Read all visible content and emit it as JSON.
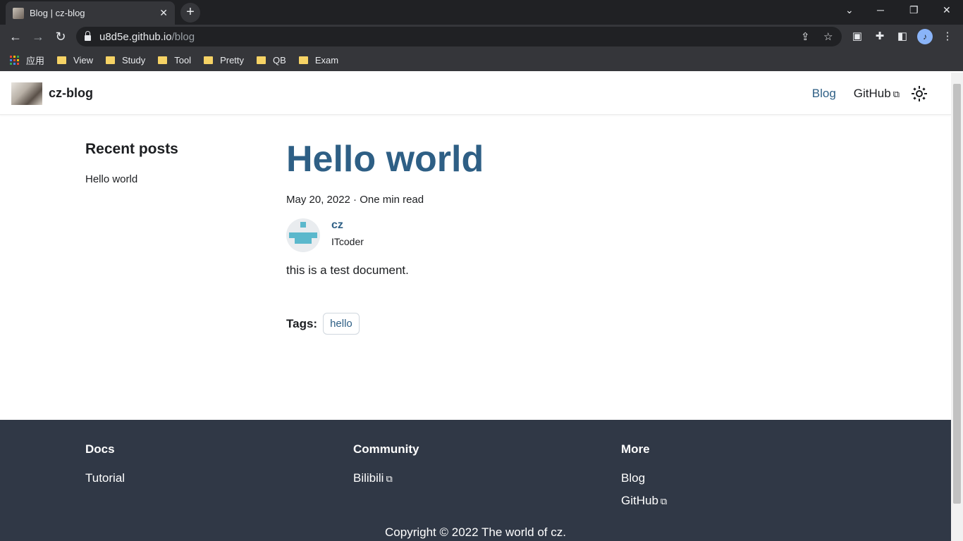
{
  "browser": {
    "tab_title": "Blog | cz-blog",
    "url_host": "u8d5e.github.io",
    "url_path": "/blog",
    "bookmarks": [
      "应用",
      "View",
      "Study",
      "Tool",
      "Pretty",
      "QB",
      "Exam"
    ]
  },
  "navbar": {
    "brand": "cz-blog",
    "links": [
      "Blog",
      "GitHub"
    ]
  },
  "sidebar": {
    "title": "Recent posts",
    "items": [
      "Hello world"
    ]
  },
  "post": {
    "title": "Hello world",
    "meta": "May 20, 2022 · One min read",
    "author_name": "cz",
    "author_title": "ITcoder",
    "body": "this is a test document.",
    "tags_label": "Tags:",
    "tags": [
      "hello"
    ]
  },
  "footer": {
    "columns": [
      {
        "title": "Docs",
        "links": [
          "Tutorial"
        ]
      },
      {
        "title": "Community",
        "links": [
          "Bilibili"
        ]
      },
      {
        "title": "More",
        "links": [
          "Blog",
          "GitHub"
        ]
      }
    ],
    "copyright": "Copyright © 2022 The world of cz."
  },
  "colors": {
    "primary": "#2e5f85",
    "footer_bg": "#303846"
  }
}
